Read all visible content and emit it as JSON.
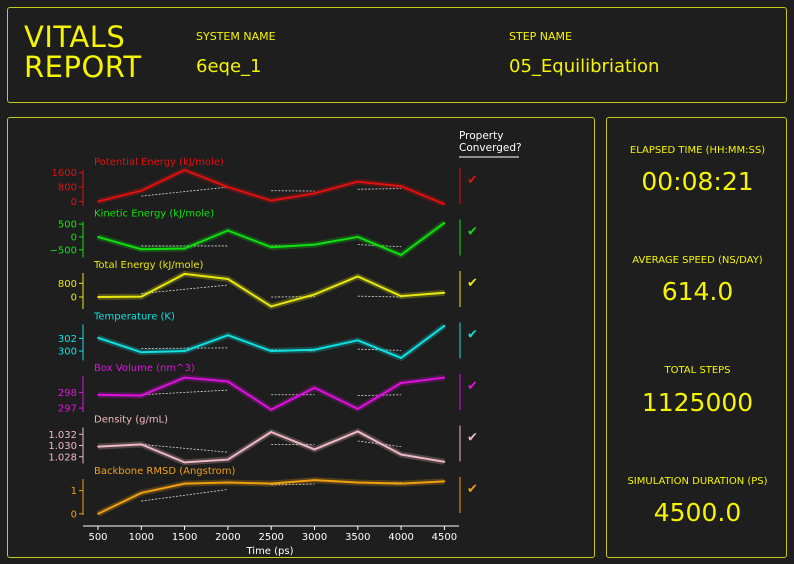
{
  "header": {
    "title_line1": "VITALS",
    "title_line2": "REPORT",
    "system_name_label": "SYSTEM NAME",
    "system_name_value": "6eqe_1",
    "step_name_label": "STEP NAME",
    "step_name_value": "05_Equilibriation"
  },
  "stats": [
    {
      "label": "ELAPSED TIME (HH:MM:SS)",
      "value": "00:08:21"
    },
    {
      "label": "AVERAGE SPEED (NS/DAY)",
      "value": "614.0"
    },
    {
      "label": "TOTAL STEPS",
      "value": "1125000"
    },
    {
      "label": "SIMULATION DURATION (PS)",
      "value": "4500.0"
    }
  ],
  "converged_header": [
    "Property",
    "Converged?"
  ],
  "chart_data": {
    "type": "line",
    "xlabel": "Time (ps)",
    "x": [
      500,
      1000,
      1500,
      2000,
      2500,
      3000,
      3500,
      4000,
      4500
    ],
    "xticks": [
      "500",
      "1000",
      "1500",
      "2000",
      "2500",
      "3000",
      "3500",
      "4000",
      "4500"
    ],
    "series": [
      {
        "name": "Potential Energy (kJ/mole)",
        "color": "#e01010",
        "values": [
          0,
          600,
          1750,
          800,
          50,
          450,
          1100,
          850,
          -150
        ],
        "ylim": [
          -250,
          1750
        ],
        "yticks": [
          {
            "v": 1600,
            "t": "1600"
          },
          {
            "v": 800,
            "t": "800"
          },
          {
            "v": 0,
            "t": "0"
          }
        ],
        "trends": [
          [
            1000,
            300,
            2000,
            800
          ],
          [
            2500,
            600,
            3000,
            580
          ],
          [
            3500,
            680,
            4000,
            720
          ]
        ],
        "converged": true,
        "check": "✔"
      },
      {
        "name": "Kinetic Energy (kJ/mole)",
        "color": "#10e010",
        "values": [
          0,
          -480,
          -450,
          250,
          -400,
          -300,
          0,
          -700,
          550
        ],
        "ylim": [
          -800,
          600
        ],
        "yticks": [
          {
            "v": 500,
            "t": "500"
          },
          {
            "v": 0,
            "t": "0"
          },
          {
            "v": -500,
            "t": "−500"
          }
        ],
        "trends": [
          [
            1000,
            -350,
            2000,
            -350
          ],
          [
            2500,
            -350,
            3000,
            -320
          ],
          [
            3500,
            -300,
            4000,
            -380
          ]
        ],
        "converged": true,
        "check": "✔"
      },
      {
        "name": "Total Energy (kJ/mole)",
        "color": "#e8e810",
        "values": [
          0,
          20,
          1350,
          1050,
          -550,
          150,
          1200,
          50,
          250
        ],
        "ylim": [
          -700,
          1400
        ],
        "yticks": [
          {
            "v": 800,
            "t": "800"
          },
          {
            "v": 0,
            "t": "0"
          }
        ],
        "trends": [
          [
            1000,
            200,
            2000,
            700
          ],
          [
            2500,
            0,
            3000,
            20
          ],
          [
            3500,
            50,
            4000,
            0
          ]
        ],
        "converged": true,
        "check": "✔"
      },
      {
        "name": "Temperature (K)",
        "color": "#10e0e0",
        "values": [
          302.1,
          299.8,
          300.0,
          302.5,
          300.0,
          300.2,
          301.7,
          298.9,
          304.0
        ],
        "ylim": [
          298.5,
          304.2
        ],
        "yticks": [
          {
            "v": 302,
            "t": "302"
          },
          {
            "v": 300,
            "t": "300"
          }
        ],
        "trends": [
          [
            1000,
            300.4,
            2000,
            300.5
          ],
          [
            2500,
            300.2,
            3000,
            300.0
          ],
          [
            3500,
            300.3,
            4000,
            300.1
          ]
        ],
        "converged": true,
        "check": "✔"
      },
      {
        "name": "Box Volume (nm^3)",
        "color": "#e010e0",
        "values": [
          297.85,
          297.8,
          298.95,
          298.7,
          296.9,
          298.3,
          296.95,
          298.6,
          298.95
        ],
        "ylim": [
          296.75,
          299.05
        ],
        "yticks": [
          {
            "v": 298,
            "t": "298"
          },
          {
            "v": 297,
            "t": "297"
          }
        ],
        "trends": [
          [
            1000,
            297.85,
            2000,
            298.15
          ],
          [
            2500,
            297.85,
            3000,
            297.85
          ],
          [
            3500,
            297.8,
            4000,
            297.85
          ]
        ],
        "converged": true,
        "check": "✔"
      },
      {
        "name": "Density (g/mL)",
        "color": "#f0b8c8",
        "values": [
          1.0298,
          1.0302,
          1.027,
          1.0275,
          1.0324,
          1.0293,
          1.0325,
          1.0284,
          1.0271
        ],
        "ylim": [
          1.0268,
          1.0332
        ],
        "yticks": [
          {
            "v": 1.032,
            "t": "1.032"
          },
          {
            "v": 1.03,
            "t": "1.030"
          },
          {
            "v": 1.028,
            "t": "1.028"
          }
        ],
        "trends": [
          [
            1000,
            1.0302,
            2000,
            1.0288
          ],
          [
            2500,
            1.0302,
            3000,
            1.0302
          ],
          [
            3500,
            1.0308,
            4000,
            1.0298
          ]
        ],
        "converged": true,
        "check": "✔"
      },
      {
        "name": "Backbone RMSD (Angstrom)",
        "color": "#f0a010",
        "values": [
          0.0,
          0.9,
          1.3,
          1.35,
          1.3,
          1.45,
          1.35,
          1.3,
          1.4
        ],
        "ylim": [
          -0.05,
          1.5
        ],
        "yticks": [
          {
            "v": 1,
            "t": "1"
          },
          {
            "v": 0,
            "t": "0"
          }
        ],
        "trends": [
          [
            1000,
            0.55,
            2000,
            1.05
          ],
          [
            2500,
            1.25,
            3000,
            1.28
          ],
          [
            3500,
            1.32,
            4000,
            1.35
          ]
        ],
        "converged": true,
        "check": "✔"
      }
    ]
  }
}
